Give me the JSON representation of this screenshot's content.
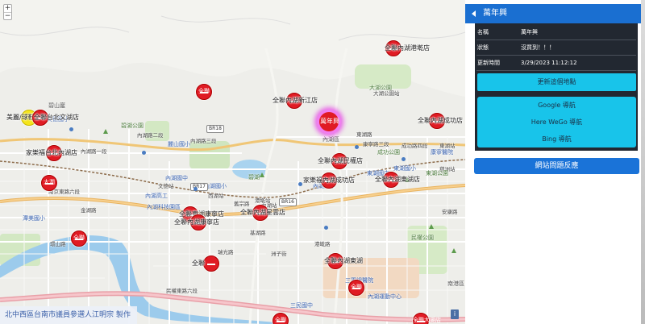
{
  "map": {
    "zoom_in": "+",
    "zoom_out": "−",
    "credit": "北中西區台南市議員參選人江明宗 製作",
    "info_button": "i",
    "selected_marker_label": "萬年興",
    "markers": [
      {
        "label": "美麗/球鞋",
        "color": "yellow"
      },
      {
        "label": "全聯",
        "color": "red"
      },
      {
        "label": "全聯台北文湖店",
        "color": "red"
      },
      {
        "label": "家樂福台北內湖店",
        "color": "red"
      },
      {
        "label": "大潤",
        "color": "red"
      },
      {
        "label": "全聯內湖新江店",
        "color": "red"
      },
      {
        "label": "全聯內湖港墘店",
        "color": "red"
      },
      {
        "label": "全聯內湖成功店",
        "color": "red"
      },
      {
        "label": "全聯內湖民權店",
        "color": "red"
      },
      {
        "label": "全聯",
        "color": "red"
      },
      {
        "label": "全聯",
        "color": "red"
      },
      {
        "label": "全聯內湖東湖店",
        "color": "red"
      },
      {
        "label": "家樂福內湖成功店",
        "color": "red"
      },
      {
        "label": "全聯內湖星雲店",
        "color": "red"
      },
      {
        "label": "全聯東湖康寧店",
        "color": "red"
      },
      {
        "label": "全聯內湖康寧店",
        "color": "red"
      },
      {
        "label": "全聯內湖東湖",
        "color": "red"
      },
      {
        "label": "全聯",
        "color": "red"
      },
      {
        "label": "全聯",
        "color": "red"
      },
      {
        "label": "全聯大湖店",
        "color": "red"
      }
    ],
    "place_labels": [
      "碧山巖",
      "文德國小",
      "碧湖公園",
      "內湖區",
      "內湖國中",
      "內湖科技園區",
      "潭美國小",
      "成功公園",
      "大湖公園",
      "康寧醫院",
      "東湖國小",
      "東湖國中",
      "南港區",
      "三軍總醫院",
      "內湖運動中心",
      "內湖高中",
      "麗山國小",
      "碧湖",
      "內湖站",
      "文德站",
      "港墘站",
      "西湖站",
      "東湖站",
      "葫洲站",
      "大湖公園站",
      "內湖國小",
      "內湖高工",
      "東湖路",
      "康寧路三段",
      "成功路四段",
      "民權東路六段",
      "內湖路一段",
      "內湖路二段",
      "內湖路三段",
      "舊宗路",
      "南京東路六段",
      "環山路",
      "金湖路",
      "安康路",
      "民權公園",
      "三民國中",
      "瑞光路",
      "洲子街",
      "基湖路",
      "港墘路",
      "東湖公園"
    ],
    "highway_labels": [
      "BR17",
      "BR16",
      "BR18"
    ]
  },
  "panel": {
    "header_title": "萬年興",
    "rows": [
      {
        "key": "名稱",
        "value": "萬年興"
      },
      {
        "key": "狀態",
        "value": "沒買到！！！"
      },
      {
        "key": "更新時間",
        "value": "3/29/2023 11:12:12"
      }
    ],
    "update_button": "更新這個地點",
    "nav_buttons": [
      "Google 導航",
      "Here WeGo 導航",
      "Bing 導航"
    ],
    "report_button": "網站問題反應"
  }
}
